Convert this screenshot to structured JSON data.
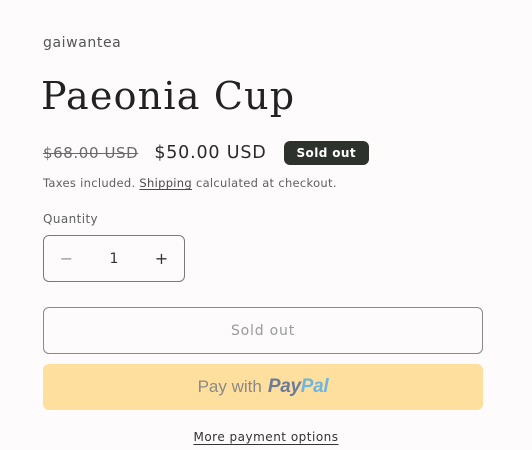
{
  "product": {
    "vendor": "gaiwantea",
    "title": "Paeonia Cup",
    "compare_price": "$68.00 USD",
    "sale_price": "$50.00 USD",
    "badge": "Sold out"
  },
  "tax_note": {
    "prefix": "Taxes included. ",
    "link": "Shipping",
    "suffix": " calculated at checkout."
  },
  "quantity": {
    "label": "Quantity",
    "value": "1",
    "minus_symbol": "−",
    "plus_symbol": "+"
  },
  "buttons": {
    "sold_out": "Sold out",
    "paypal_prefix": "Pay with",
    "paypal_logo_part1": "Pay",
    "paypal_logo_part2": "Pal",
    "more_payment_options": "More payment options"
  },
  "colors": {
    "background": "#fdfbfb",
    "badge": "#2e322d",
    "paypal_button": "#ffdf9d",
    "paypal_dark": "#6b7b9a",
    "paypal_light": "#6fb6de"
  }
}
